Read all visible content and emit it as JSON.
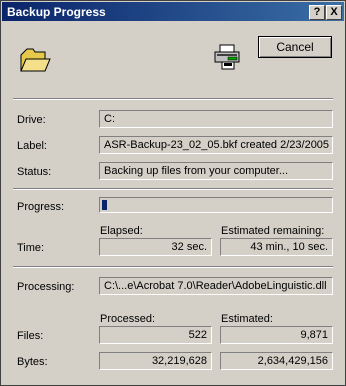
{
  "window": {
    "title": "Backup Progress",
    "help_btn": "?",
    "close_btn": "X"
  },
  "cancel_label": "Cancel",
  "drive": {
    "label": "Drive:",
    "value": "C:"
  },
  "backup_label": {
    "label": "Label:",
    "value": "ASR-Backup-23_02_05.bkf created 2/23/2005"
  },
  "status": {
    "label": "Status:",
    "value": "Backing up files from your computer..."
  },
  "progress": {
    "label": "Progress:",
    "fraction": 0.02
  },
  "time": {
    "label": "Time:",
    "elapsed_header": "Elapsed:",
    "elapsed": "32 sec.",
    "remaining_header": "Estimated remaining:",
    "remaining": "43 min., 10 sec."
  },
  "processing": {
    "label": "Processing:",
    "value": "C:\\...e\\Acrobat 7.0\\Reader\\AdobeLinguistic.dll"
  },
  "counts": {
    "processed_header": "Processed:",
    "estimated_header": "Estimated:",
    "files_label": "Files:",
    "files_processed": "522",
    "files_estimated": "9,871",
    "bytes_label": "Bytes:",
    "bytes_processed": "32,219,628",
    "bytes_estimated": "2,634,429,156"
  },
  "icons": {
    "folder": "open-folder-icon",
    "drive": "backup-drive-icon"
  }
}
